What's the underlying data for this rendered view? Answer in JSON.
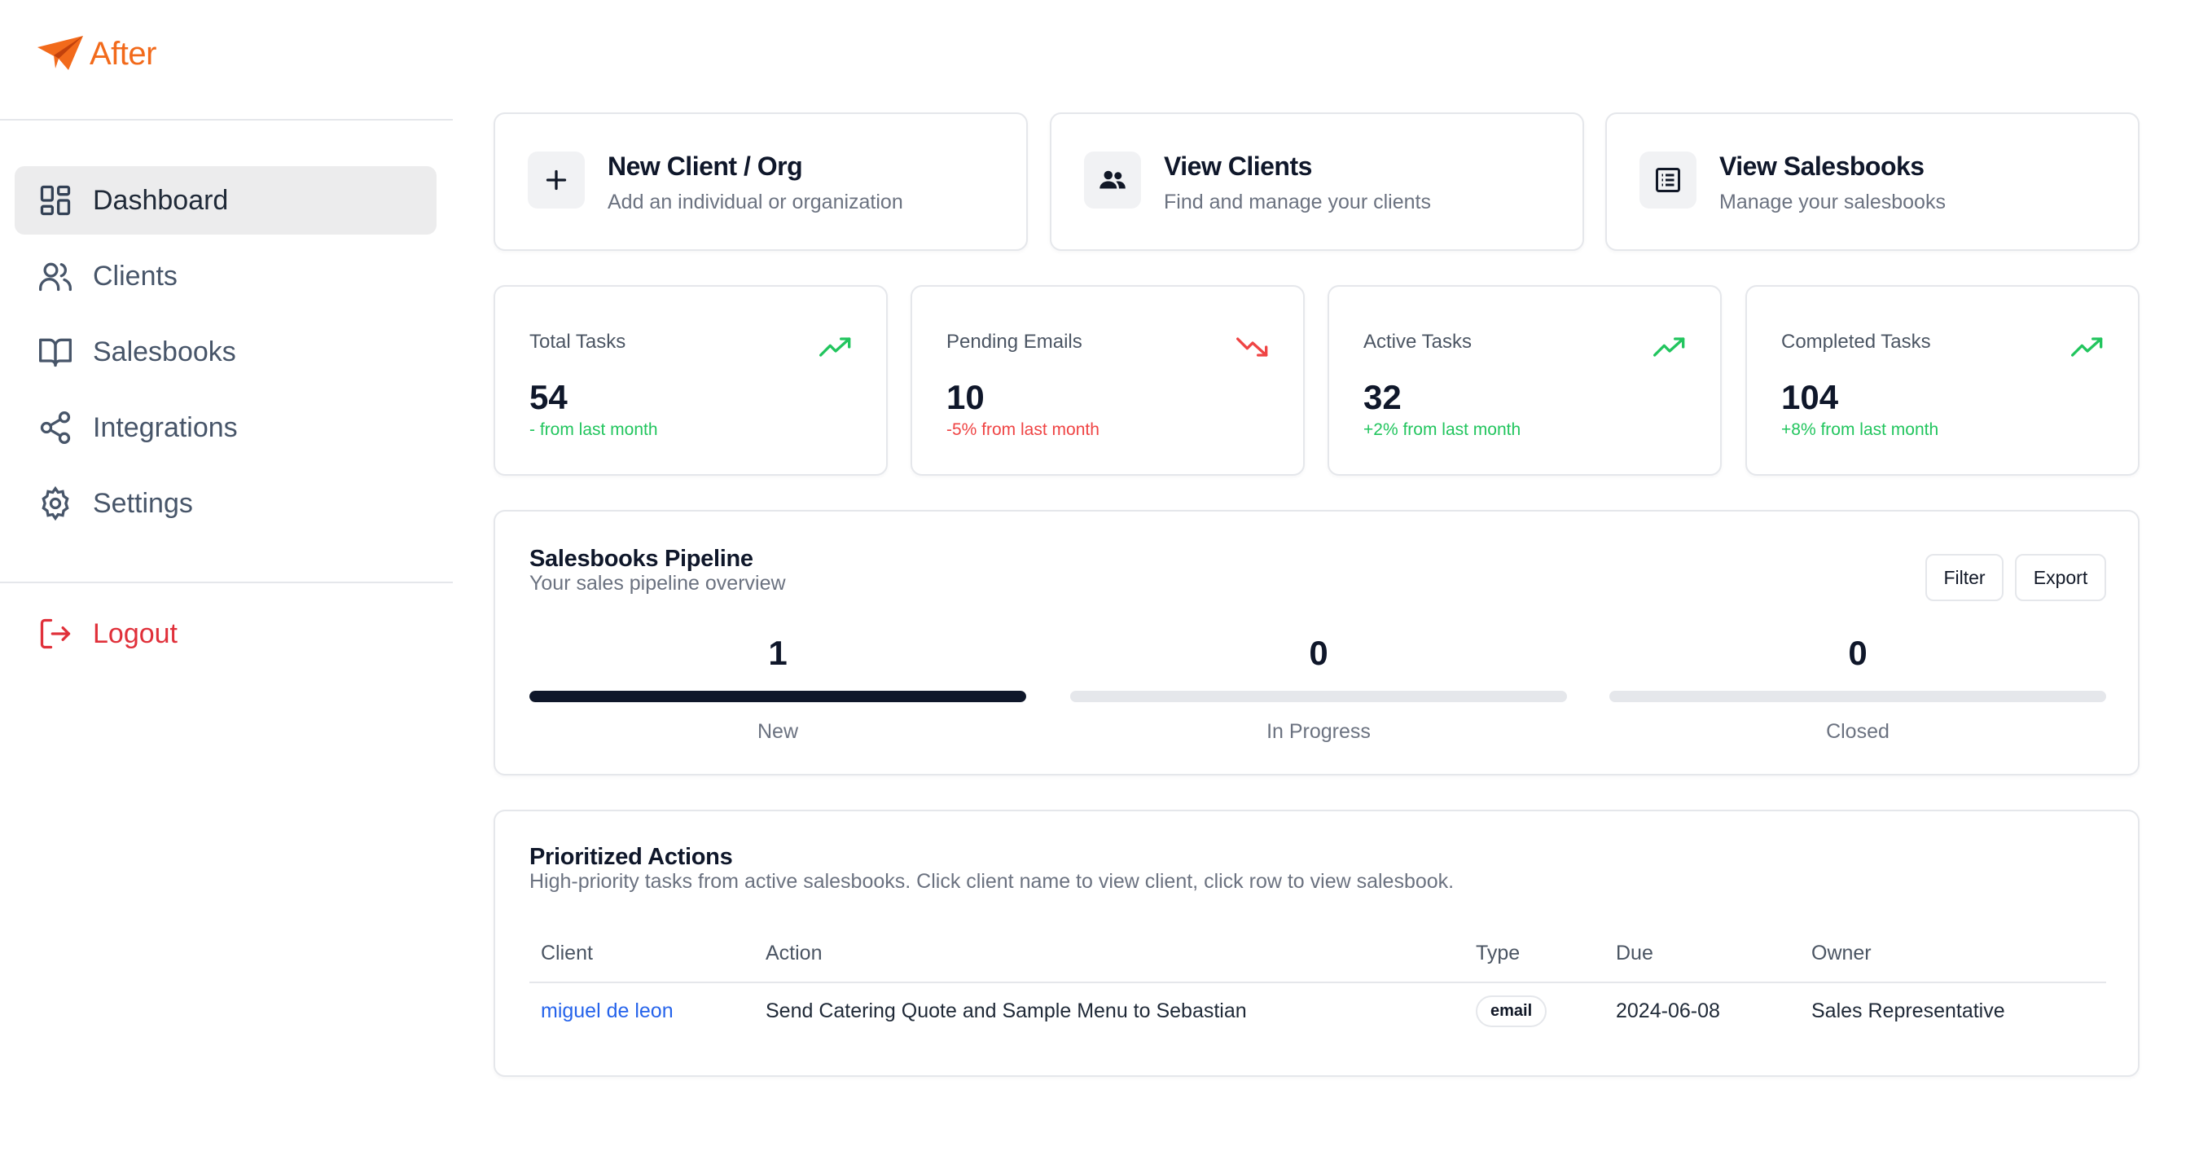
{
  "brand": {
    "name": "After",
    "accent": "#f26a1b"
  },
  "sidebar": {
    "items": [
      {
        "label": "Dashboard",
        "icon": "dashboard-icon",
        "active": true
      },
      {
        "label": "Clients",
        "icon": "users-icon"
      },
      {
        "label": "Salesbooks",
        "icon": "book-icon"
      },
      {
        "label": "Integrations",
        "icon": "share-icon"
      },
      {
        "label": "Settings",
        "icon": "gear-icon"
      }
    ],
    "logout": {
      "label": "Logout",
      "icon": "logout-icon",
      "color": "#e0303a"
    }
  },
  "quick_actions": [
    {
      "title": "New Client / Org",
      "subtitle": "Add an individual or organization",
      "icon": "plus-icon"
    },
    {
      "title": "View Clients",
      "subtitle": "Find and manage your clients",
      "icon": "people-icon"
    },
    {
      "title": "View Salesbooks",
      "subtitle": "Manage your salesbooks",
      "icon": "list-icon"
    }
  ],
  "stats": [
    {
      "label": "Total Tasks",
      "value": "54",
      "change": "- from last month",
      "trend": "up"
    },
    {
      "label": "Pending Emails",
      "value": "10",
      "change": "-5% from last month",
      "trend": "down"
    },
    {
      "label": "Active Tasks",
      "value": "32",
      "change": "+2% from last month",
      "trend": "up"
    },
    {
      "label": "Completed Tasks",
      "value": "104",
      "change": "+8% from last month",
      "trend": "up"
    }
  ],
  "pipeline": {
    "title": "Salesbooks Pipeline",
    "subtitle": "Your sales pipeline overview",
    "filter_label": "Filter",
    "export_label": "Export",
    "stages": [
      {
        "count": "1",
        "label": "New",
        "fill": 1.0
      },
      {
        "count": "0",
        "label": "In Progress",
        "fill": 0.0
      },
      {
        "count": "0",
        "label": "Closed",
        "fill": 0.0
      }
    ]
  },
  "prioritized": {
    "title": "Prioritized Actions",
    "subtitle": "High-priority tasks from active salesbooks. Click client name to view client, click row to view salesbook.",
    "columns": [
      "Client",
      "Action",
      "Type",
      "Due",
      "Owner"
    ],
    "rows": [
      {
        "client": "miguel de leon",
        "action": "Send Catering Quote and Sample Menu to Sebastian",
        "type": "email",
        "due": "2024-06-08",
        "owner": "Sales Representative"
      }
    ]
  }
}
